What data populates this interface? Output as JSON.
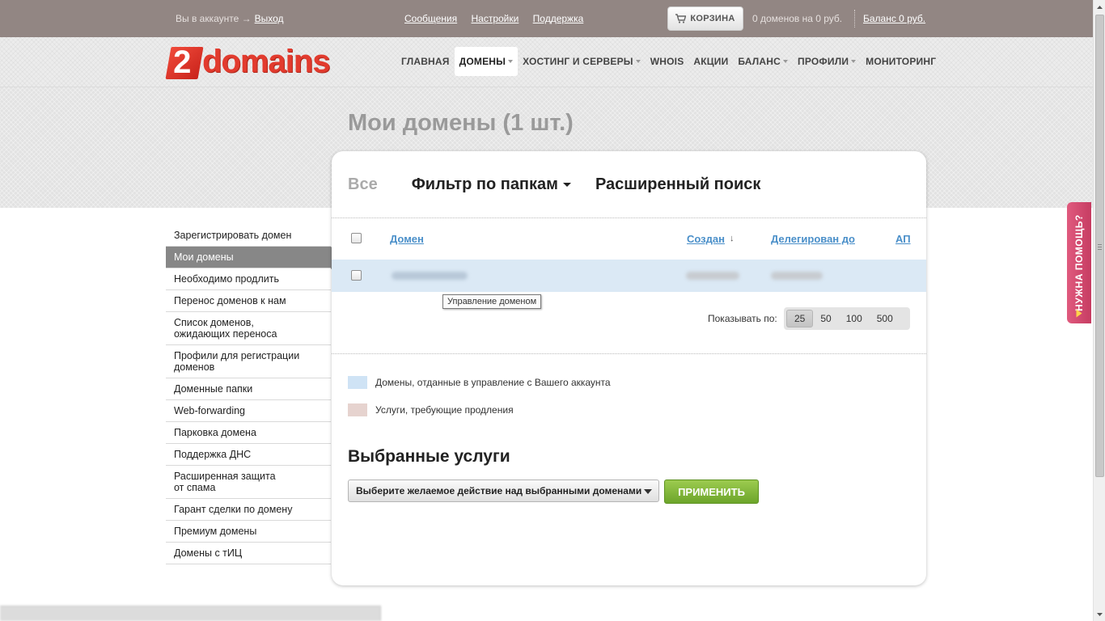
{
  "topbar": {
    "logged_text": "Вы в аккаунте →",
    "logout": "Выход",
    "links": [
      "Сообщения",
      "Настройки",
      "Поддержка"
    ],
    "cart_label": "КОРЗИНА",
    "cart_info": "0 доменов на 0 руб.",
    "balance": "Баланс 0 руб."
  },
  "logo": {
    "digit": "2",
    "word": "domains"
  },
  "nav": [
    {
      "label": "ГЛАВНАЯ",
      "caret": false,
      "active": false
    },
    {
      "label": "ДОМЕНЫ",
      "caret": true,
      "active": true
    },
    {
      "label": "ХОСТИНГ И СЕРВЕРЫ",
      "caret": true,
      "active": false
    },
    {
      "label": "WHOIS",
      "caret": false,
      "active": false
    },
    {
      "label": "АКЦИИ",
      "caret": false,
      "active": false
    },
    {
      "label": "БАЛАНС",
      "caret": true,
      "active": false
    },
    {
      "label": "ПРОФИЛИ",
      "caret": true,
      "active": false
    },
    {
      "label": "МОНИТОРИНГ",
      "caret": false,
      "active": false
    }
  ],
  "page_title": "Мои домены (1 шт.)",
  "sidebar": [
    "Зарегистрировать домен",
    "Мои домены",
    "Необходимо продлить",
    "Перенос доменов к нам",
    "Список доменов, ожидающих переноса",
    "Профили для регистрации доменов",
    "Доменные папки",
    "Web-forwarding",
    "Парковка домена",
    "Поддержка ДНС",
    "Расширенная защита от спама",
    "Гарант сделки по домену",
    "Премиум домены",
    "Домены с тИЦ"
  ],
  "sidebar_active": 1,
  "tabs": {
    "all": "Все",
    "filter": "Фильтр по папкам",
    "advanced": "Расширенный поиск"
  },
  "table": {
    "col_domain": "Домен",
    "col_created": "Создан",
    "sort_indicator": "↓",
    "col_delegated": "Делегирован до",
    "col_ap": "АП"
  },
  "tooltip": "Управление доменом",
  "per_page": {
    "label": "Показывать по:",
    "options": [
      "25",
      "50",
      "100",
      "500"
    ],
    "selected": "25"
  },
  "legend": [
    {
      "color": "#cfe3f5",
      "text": "Домены, отданные в управление с Вашего аккаунта"
    },
    {
      "color": "#e6d3cf",
      "text": "Услуги, требующие продления"
    }
  ],
  "services": {
    "title": "Выбранные услуги",
    "select_value": "Выберите желаемое действие над выбранными доменами",
    "apply": "ПРИМЕНИТЬ"
  },
  "help_tab": "НУЖНА ПОМОЩЬ?",
  "colors": {
    "topbar": "#928683",
    "link_blue": "#4a8fc9",
    "apply_green": "#7cb434",
    "row_highlight": "#dbe9f5",
    "help_pink": "#d44a70"
  }
}
